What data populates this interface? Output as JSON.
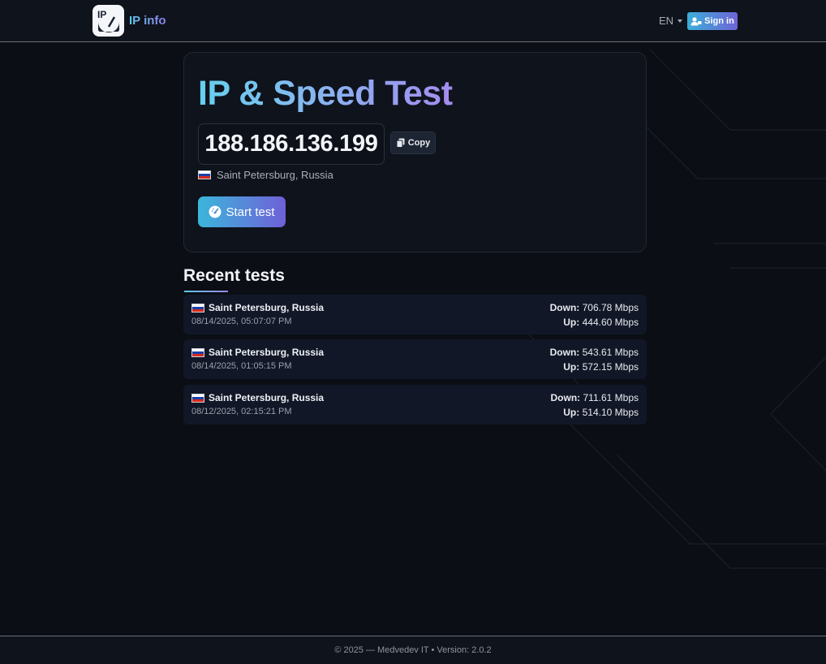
{
  "brand": {
    "name": "IP info",
    "logo_text": "IP"
  },
  "nav": {
    "language": "EN",
    "signin_label": "Sign in"
  },
  "hero": {
    "title": "IP & Speed Test",
    "ip": "188.186.136.199",
    "copy_label": "Copy",
    "location": "Saint Petersburg, Russia",
    "start_label": "Start test"
  },
  "recent": {
    "title": "Recent tests",
    "down_label": "Down:",
    "up_label": "Up:",
    "items": [
      {
        "location": "Saint Petersburg, Russia",
        "date": "08/14/2025, 05:07:07 PM",
        "down": "706.78 Mbps",
        "up": "444.60 Mbps"
      },
      {
        "location": "Saint Petersburg, Russia",
        "date": "08/14/2025, 01:05:15 PM",
        "down": "543.61 Mbps",
        "up": "572.15 Mbps"
      },
      {
        "location": "Saint Petersburg, Russia",
        "date": "08/12/2025, 02:15:21 PM",
        "down": "711.61 Mbps",
        "up": "514.10 Mbps"
      }
    ]
  },
  "footer": {
    "text": "© 2025 — Medvedev IT • Version: 2.0.2"
  },
  "colors": {
    "accent_start": "#5cc8ea",
    "accent_end": "#8f7ff0",
    "background": "#0b0e14",
    "card": "#0f131c"
  },
  "icons": {
    "copy": "copy-icon",
    "start": "speedometer-icon",
    "signin": "user-icon",
    "flag": "russia-flag-icon"
  }
}
